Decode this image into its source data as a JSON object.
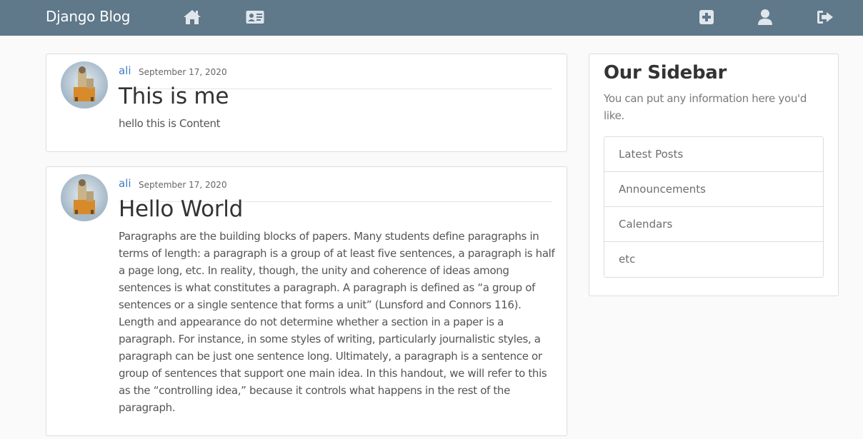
{
  "navbar": {
    "brand": "Django Blog",
    "icons": [
      "home-icon",
      "id-card-icon",
      "plus-square-icon",
      "user-icon",
      "sign-out-icon"
    ],
    "color": "#5f788a"
  },
  "posts": [
    {
      "author": "ali",
      "date": "September 17, 2020",
      "title": "This is me",
      "content": "hello this is Content"
    },
    {
      "author": "ali",
      "date": "September 17, 2020",
      "title": "Hello World",
      "content": "Paragraphs are the building blocks of papers. Many students define paragraphs in terms of length: a paragraph is a group of at least five sentences, a paragraph is half a page long, etc. In reality, though, the unity and coherence of ideas among sentences is what constitutes a paragraph. A paragraph is defined as “a group of sentences or a single sentence that forms a unit” (Lunsford and Connors 116). Length and appearance do not determine whether a section in a paper is a paragraph. For instance, in some styles of writing, particularly journalistic styles, a paragraph can be just one sentence long. Ultimately, a paragraph is a sentence or group of sentences that support one main idea. In this handout, we will refer to this as the “controlling idea,” because it controls what happens in the rest of the paragraph."
    }
  ],
  "sidebar": {
    "title": "Our Sidebar",
    "text": "You can put any information here you'd like.",
    "items": [
      "Latest Posts",
      "Announcements",
      "Calendars",
      "etc"
    ]
  },
  "colors": {
    "link": "#3a7fc4",
    "border": "#dddddd"
  }
}
